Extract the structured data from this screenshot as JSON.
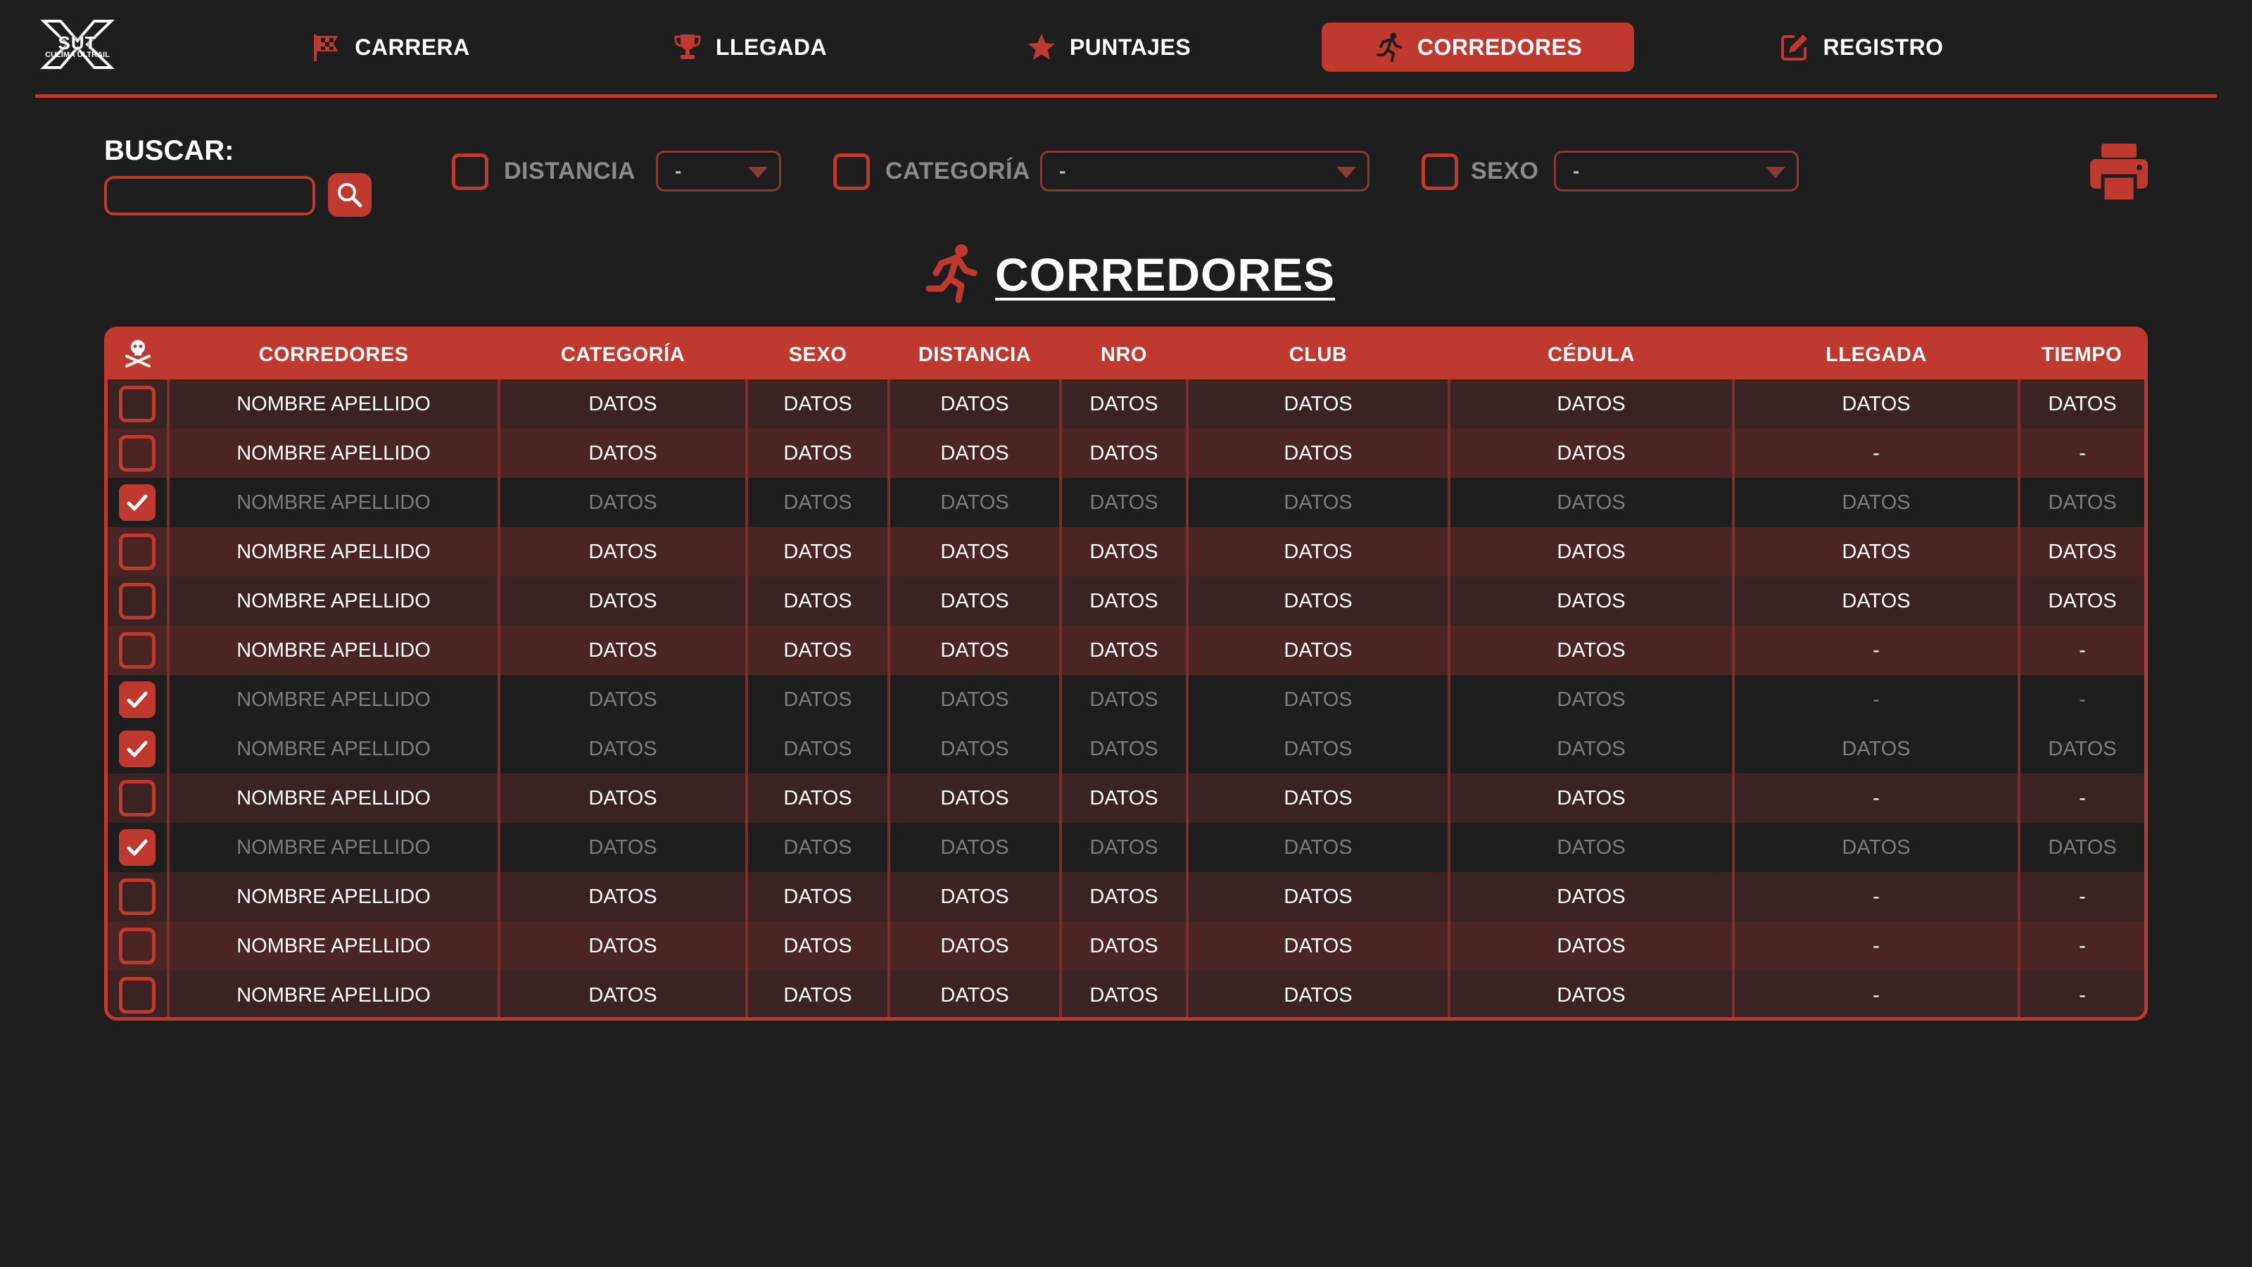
{
  "logo": {
    "text": "SUT",
    "subtext": "CULIMA ULTRAIL"
  },
  "nav": [
    {
      "label": "CARRERA",
      "icon": "flag-icon",
      "active": false
    },
    {
      "label": "LLEGADA",
      "icon": "trophy-icon",
      "active": false
    },
    {
      "label": "PUNTAJES",
      "icon": "star-icon",
      "active": false
    },
    {
      "label": "CORREDORES",
      "icon": "runner-icon",
      "active": true
    },
    {
      "label": "REGISTRO",
      "icon": "edit-icon",
      "active": false
    }
  ],
  "filters": {
    "search_label": "BUSCAR:",
    "search_value": "",
    "distance": {
      "label": "DISTANCIA",
      "value": "-"
    },
    "category": {
      "label": "CATEGORÍA",
      "value": "-"
    },
    "sex": {
      "label": "SEXO",
      "value": "-"
    }
  },
  "page_title": "CORREDORES",
  "colors": {
    "accent": "#c0392f",
    "background": "#1e1e1e",
    "row_odd": "#3a2322",
    "row_even": "#4a2523",
    "muted_text": "#7d7d7d"
  },
  "table": {
    "header_icon": "skull-crossbones-icon",
    "columns": [
      "CORREDORES",
      "CATEGORÍA",
      "SEXO",
      "DISTANCIA",
      "NRO",
      "CLUB",
      "CÉDULA",
      "LLEGADA",
      "TIEMPO"
    ],
    "rows": [
      {
        "checked": false,
        "cells": [
          "NOMBRE APELLIDO",
          "DATOS",
          "DATOS",
          "DATOS",
          "DATOS",
          "DATOS",
          "DATOS",
          "DATOS",
          "DATOS"
        ]
      },
      {
        "checked": false,
        "cells": [
          "NOMBRE APELLIDO",
          "DATOS",
          "DATOS",
          "DATOS",
          "DATOS",
          "DATOS",
          "DATOS",
          "-",
          "-"
        ]
      },
      {
        "checked": true,
        "cells": [
          "NOMBRE APELLIDO",
          "DATOS",
          "DATOS",
          "DATOS",
          "DATOS",
          "DATOS",
          "DATOS",
          "DATOS",
          "DATOS"
        ]
      },
      {
        "checked": false,
        "cells": [
          "NOMBRE APELLIDO",
          "DATOS",
          "DATOS",
          "DATOS",
          "DATOS",
          "DATOS",
          "DATOS",
          "DATOS",
          "DATOS"
        ]
      },
      {
        "checked": false,
        "cells": [
          "NOMBRE APELLIDO",
          "DATOS",
          "DATOS",
          "DATOS",
          "DATOS",
          "DATOS",
          "DATOS",
          "DATOS",
          "DATOS"
        ]
      },
      {
        "checked": false,
        "cells": [
          "NOMBRE APELLIDO",
          "DATOS",
          "DATOS",
          "DATOS",
          "DATOS",
          "DATOS",
          "DATOS",
          "-",
          "-"
        ]
      },
      {
        "checked": true,
        "cells": [
          "NOMBRE APELLIDO",
          "DATOS",
          "DATOS",
          "DATOS",
          "DATOS",
          "DATOS",
          "DATOS",
          "-",
          "-"
        ]
      },
      {
        "checked": true,
        "cells": [
          "NOMBRE APELLIDO",
          "DATOS",
          "DATOS",
          "DATOS",
          "DATOS",
          "DATOS",
          "DATOS",
          "DATOS",
          "DATOS"
        ]
      },
      {
        "checked": false,
        "cells": [
          "NOMBRE APELLIDO",
          "DATOS",
          "DATOS",
          "DATOS",
          "DATOS",
          "DATOS",
          "DATOS",
          "-",
          "-"
        ]
      },
      {
        "checked": true,
        "cells": [
          "NOMBRE APELLIDO",
          "DATOS",
          "DATOS",
          "DATOS",
          "DATOS",
          "DATOS",
          "DATOS",
          "DATOS",
          "DATOS"
        ]
      },
      {
        "checked": false,
        "cells": [
          "NOMBRE APELLIDO",
          "DATOS",
          "DATOS",
          "DATOS",
          "DATOS",
          "DATOS",
          "DATOS",
          "-",
          "-"
        ]
      },
      {
        "checked": false,
        "cells": [
          "NOMBRE APELLIDO",
          "DATOS",
          "DATOS",
          "DATOS",
          "DATOS",
          "DATOS",
          "DATOS",
          "-",
          "-"
        ]
      },
      {
        "checked": false,
        "cells": [
          "NOMBRE APELLIDO",
          "DATOS",
          "DATOS",
          "DATOS",
          "DATOS",
          "DATOS",
          "DATOS",
          "-",
          "-"
        ]
      }
    ]
  }
}
